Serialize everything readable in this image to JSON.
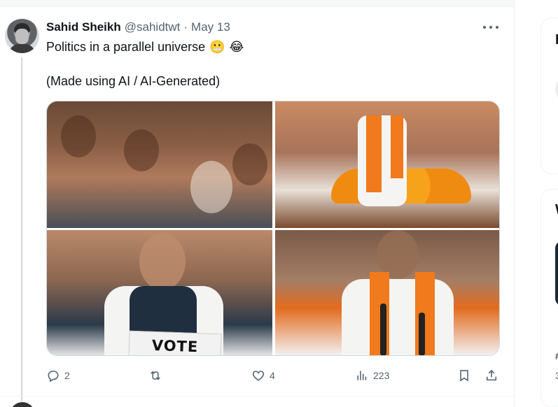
{
  "tweet": {
    "author_name": "Sahid Sheikh",
    "handle": "@sahidtwt",
    "separator": "·",
    "date": "May 13",
    "text_line1": "Politics in a parallel universe",
    "emoji": [
      "😬",
      "😂"
    ],
    "text_line2": "(Made using AI / AI-Generated)",
    "more_icon": "more-horizontal-icon",
    "vote_sign": "VOTE"
  },
  "actions": {
    "reply_count": "2",
    "repost_count": "",
    "like_count": "4",
    "views_count": "223",
    "icons": [
      "reply-icon",
      "repost-icon",
      "like-icon",
      "views-icon",
      "bookmark-icon",
      "share-icon"
    ]
  },
  "sidebar": {
    "card1_title_fragment": "I",
    "card2_title_fragment": "W",
    "card2_marks": [
      "#",
      "3"
    ]
  },
  "colors": {
    "text_primary": "#0f1419",
    "text_secondary": "#536471",
    "border": "#cfd9de",
    "saffron": "#f07a1c"
  }
}
